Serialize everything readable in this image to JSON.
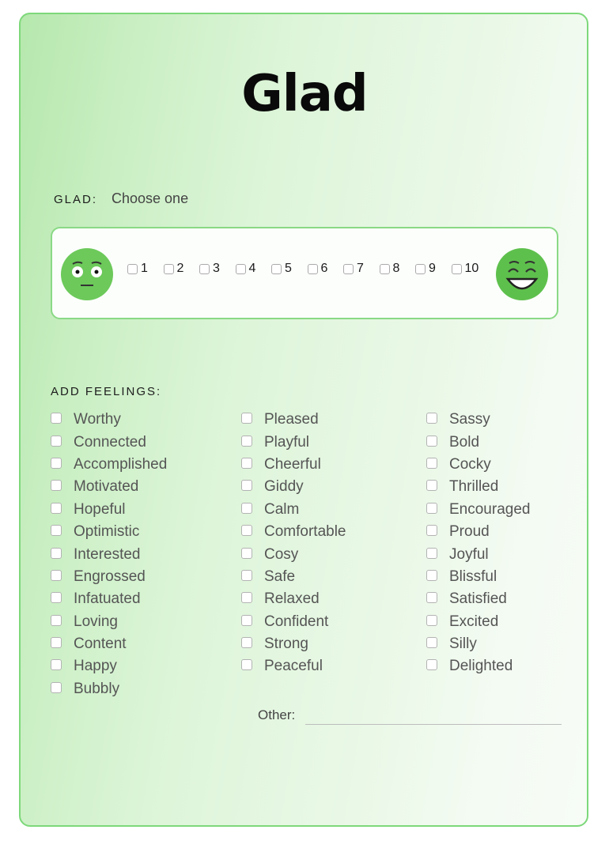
{
  "title": "Glad",
  "glad": {
    "label": "GLAD:",
    "instruction": "Choose one",
    "scale": [
      "1",
      "2",
      "3",
      "4",
      "5",
      "6",
      "7",
      "8",
      "9",
      "10"
    ],
    "low_icon": "neutral-face-icon",
    "high_icon": "laughing-face-icon"
  },
  "feelings": {
    "label": "ADD FEELINGS:",
    "columns": [
      [
        "Worthy",
        "Connected",
        "Accomplished",
        "Motivated",
        "Hopeful",
        "Optimistic",
        "Interested",
        "Engrossed",
        "Infatuated",
        "Loving",
        "Content",
        "Happy",
        "Bubbly"
      ],
      [
        "Pleased",
        "Playful",
        "Cheerful",
        "Giddy",
        "Calm",
        "Comfortable",
        "Cosy",
        "Safe",
        "Relaxed",
        "Confident",
        "Strong",
        "Peaceful"
      ],
      [
        "Sassy",
        "Bold",
        "Cocky",
        "Thrilled",
        "Encouraged",
        "Proud",
        "Joyful",
        "Blissful",
        "Satisfied",
        "Excited",
        "Silly",
        "Delighted"
      ]
    ]
  },
  "other": {
    "label": "Other:",
    "value": ""
  },
  "colors": {
    "accent": "#6cc55f",
    "border": "#7dd87a"
  }
}
